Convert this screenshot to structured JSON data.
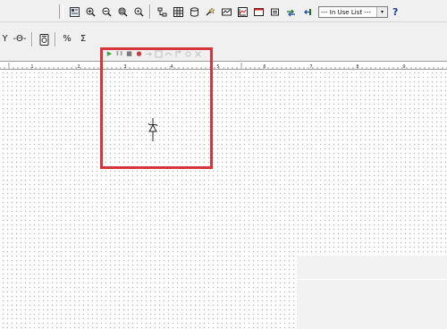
{
  "toolbar": {
    "in_use_list": {
      "selected": "--- In Use List ---",
      "arrow": "▾"
    },
    "help_label": "?",
    "icons": [
      "design-toolbox-icon",
      "zoom-in-icon",
      "zoom-out-icon",
      "zoom-area-icon",
      "zoom-fit-icon",
      "hierarchy-icon",
      "spreadsheet-icon",
      "database-icon",
      "component-wizard-icon",
      "postprocessor-icon",
      "grapher-icon",
      "description-box-icon",
      "electrical-rules-icon",
      "transfer-icon",
      "back-annotate-icon"
    ]
  },
  "left_toolbar": {
    "labels": [
      "Y",
      "-Θ-",
      "Θ",
      "%",
      "Ʃ"
    ]
  },
  "simulation": {
    "run_label": "▶",
    "pause_label": "❚❚",
    "stop_label": "■",
    "probe_label": "●"
  },
  "ruler": {
    "marks": [
      "1",
      "2",
      "3",
      "4",
      "5",
      "6",
      "7",
      "8",
      "9"
    ]
  },
  "highlight": {
    "color": "#d8343c"
  },
  "colors": {
    "chrome": "#f0f0f0",
    "canvas": "#ffffff",
    "grid_dot": "#b8b8b8",
    "run_green": "#3aa53a"
  }
}
